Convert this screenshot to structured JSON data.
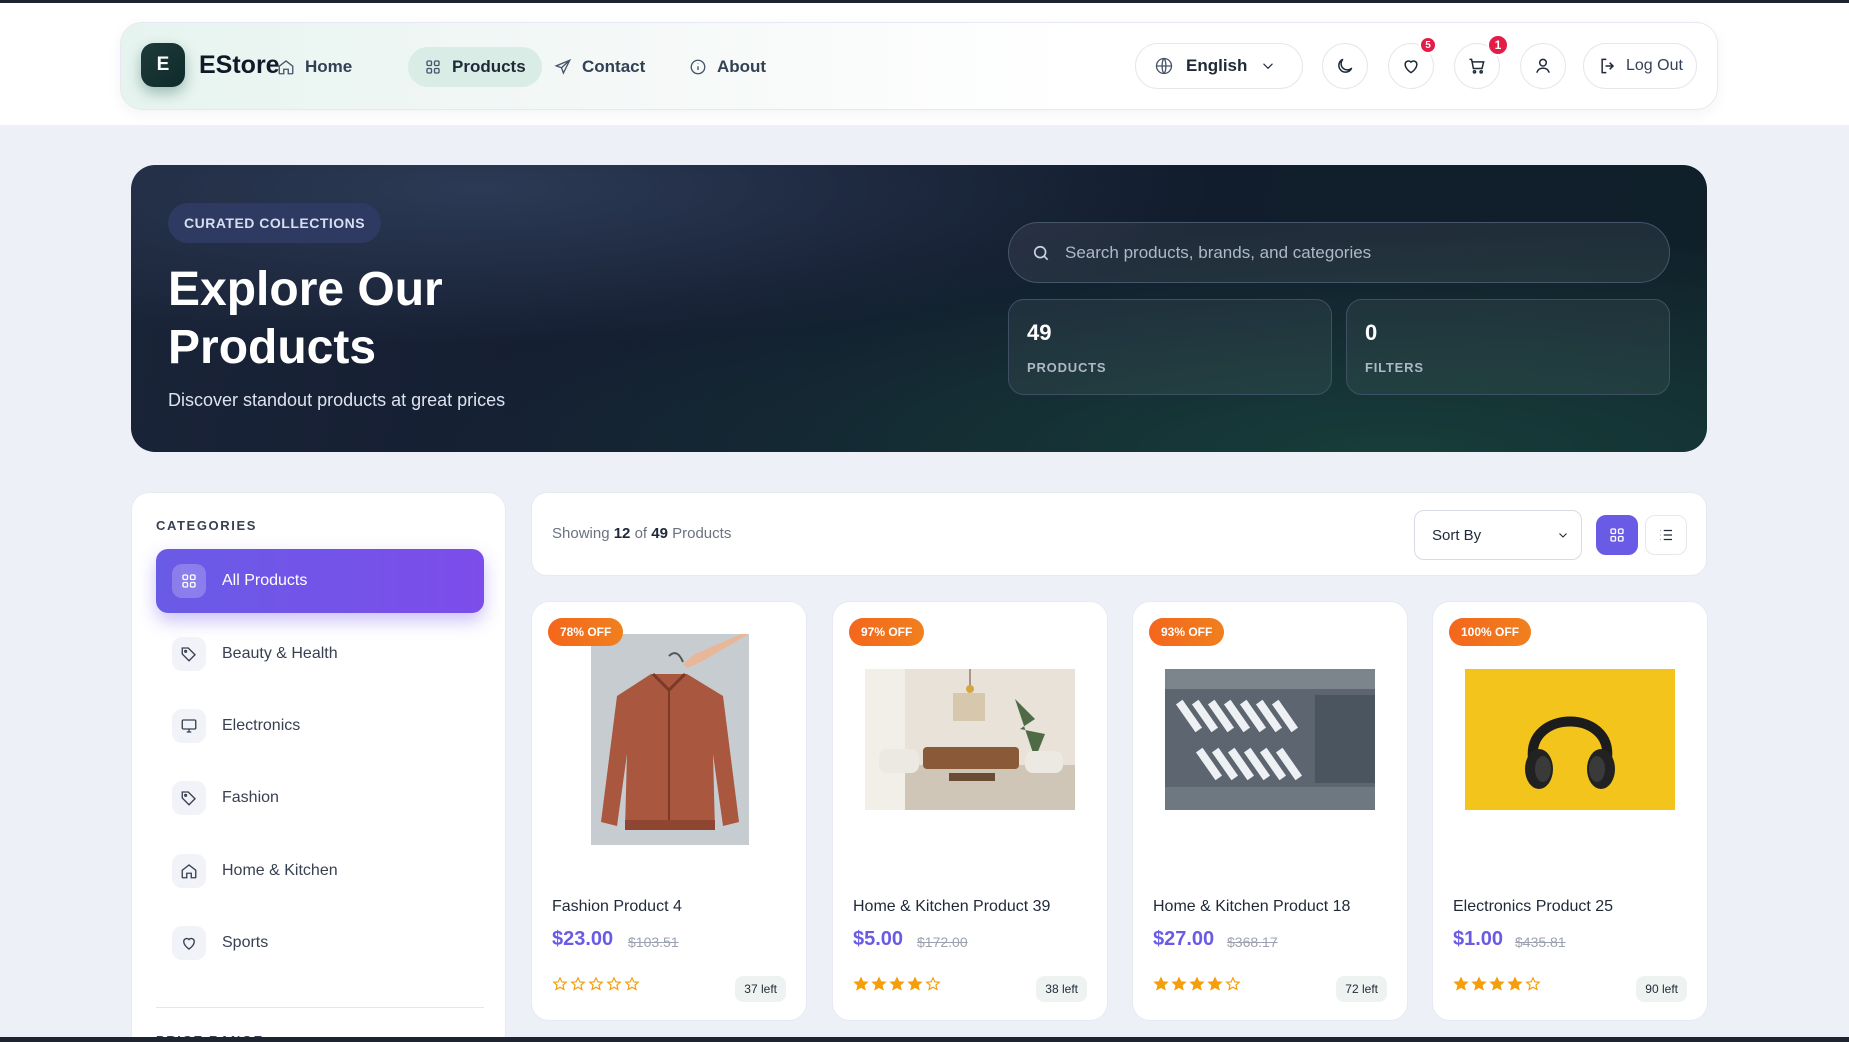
{
  "brand": {
    "logo_letter": "E",
    "name": "EStore"
  },
  "nav": {
    "items": [
      {
        "label": "Home",
        "icon": "home-icon"
      },
      {
        "label": "Products",
        "icon": "grid-icon",
        "active": true
      },
      {
        "label": "Contact",
        "icon": "send-icon"
      },
      {
        "label": "About",
        "icon": "info-icon"
      }
    ],
    "language": "English",
    "wishlist_count": "5",
    "cart_count": "1",
    "logout_label": "Log Out"
  },
  "hero": {
    "tag": "CURATED COLLECTIONS",
    "title": "Explore Our Products",
    "subtitle": "Discover standout products at great prices",
    "search_placeholder": "Search products, brands, and categories",
    "stats": [
      {
        "value": "49",
        "label": "PRODUCTS"
      },
      {
        "value": "0",
        "label": "FILTERS"
      }
    ]
  },
  "sidebar": {
    "heading": "CATEGORIES",
    "categories": [
      {
        "label": "All Products",
        "icon": "grid-icon",
        "active": true
      },
      {
        "label": "Beauty & Health",
        "icon": "tag-icon"
      },
      {
        "label": "Electronics",
        "icon": "monitor-icon"
      },
      {
        "label": "Fashion",
        "icon": "tag-icon"
      },
      {
        "label": "Home & Kitchen",
        "icon": "home-icon"
      },
      {
        "label": "Sports",
        "icon": "heart-icon"
      }
    ],
    "next_heading": "PRICE RANGE"
  },
  "toolbar": {
    "showing_prefix": "Showing",
    "shown": "12",
    "of": "of",
    "total": "49",
    "suffix": "Products",
    "sort_label": "Sort By"
  },
  "products": [
    {
      "discount": "78% OFF",
      "name": "Fashion Product 4",
      "price": "$23.00",
      "old_price": "$103.51",
      "rating": 0,
      "stock": "37 left",
      "image": "jacket"
    },
    {
      "discount": "97% OFF",
      "name": "Home & Kitchen Product 39",
      "price": "$5.00",
      "old_price": "$172.00",
      "rating": 4,
      "stock": "38 left",
      "image": "living-room"
    },
    {
      "discount": "93% OFF",
      "name": "Home & Kitchen Product 18",
      "price": "$27.00",
      "old_price": "$368.17",
      "rating": 4,
      "stock": "72 left",
      "image": "trucks-aerial"
    },
    {
      "discount": "100% OFF",
      "name": "Electronics Product 25",
      "price": "$1.00",
      "old_price": "$435.81",
      "rating": 4,
      "stock": "90 left",
      "image": "headphones"
    }
  ],
  "colors": {
    "accent": "#6a5be6",
    "discount": "#f4661c",
    "star": "#f59e0b",
    "hero_bg": "#141d30"
  }
}
